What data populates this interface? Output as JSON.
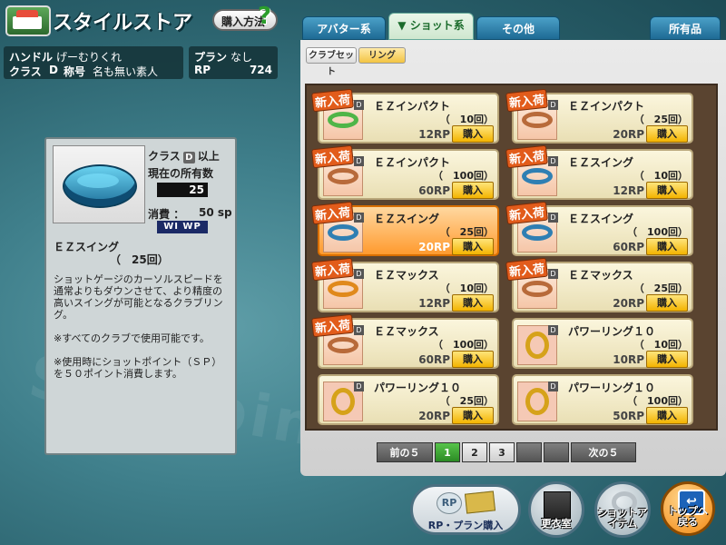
{
  "header": {
    "title": "スタイルストア",
    "howto_label": "購入方法",
    "howto_q": "?"
  },
  "user": {
    "handle_label": "ハンドル",
    "handle_value": "げーむりくれ",
    "class_label": "クラス",
    "class_value": "D",
    "title_label": "称号",
    "title_value": "名も無い素人",
    "plan_label": "プラン",
    "plan_value": "なし",
    "rp_label": "RP",
    "rp_value": "724"
  },
  "tabs": {
    "avatar": "アバター系",
    "shot": "ショット系",
    "other": "その他",
    "owned": "所有品"
  },
  "subtabs": {
    "clubset": "クラブセット",
    "ring": "リング"
  },
  "detail": {
    "class_label": "クラス",
    "class_badge": "D",
    "class_suffix": "以上",
    "owned_label": "現在の所有数",
    "owned_count": "25",
    "cost_label": "消費 ：",
    "cost_value": "50 sp",
    "wp_label": "WI WP",
    "name": "ＥＺスイング",
    "uses": "（　25回）",
    "desc1": "ショットゲージのカーソルスピードを通常よりもダウンさせて、より精度の高いスイングが可能となるクラブリング。",
    "desc2": "※すべてのクラブで使用可能です。",
    "desc3": "※使用時にショットポイント（ＳＰ）を５０ポイント消費します。"
  },
  "items": [
    {
      "name": "ＥＺインパクト",
      "uses": "（　10回）",
      "price": "12RP",
      "buy": "購入",
      "new": "新入荷",
      "color": "#4fb548"
    },
    {
      "name": "ＥＺインパクト",
      "uses": "（　25回）",
      "price": "20RP",
      "buy": "購入",
      "new": "新入荷",
      "color": "#b86a3a"
    },
    {
      "name": "ＥＺインパクト",
      "uses": "（　100回）",
      "price": "60RP",
      "buy": "購入",
      "new": "新入荷",
      "color": "#b86a3a"
    },
    {
      "name": "ＥＺスイング",
      "uses": "（　10回）",
      "price": "12RP",
      "buy": "購入",
      "new": "新入荷",
      "color": "#2f7fb3"
    },
    {
      "name": "ＥＺスイング",
      "uses": "（　25回）",
      "price": "20RP",
      "buy": "購入",
      "new": "新入荷",
      "color": "#2f7fb3"
    },
    {
      "name": "ＥＺスイング",
      "uses": "（　100回）",
      "price": "60RP",
      "buy": "購入",
      "new": "新入荷",
      "color": "#2f7fb3"
    },
    {
      "name": "ＥＺマックス",
      "uses": "（　10回）",
      "price": "12RP",
      "buy": "購入",
      "new": "新入荷",
      "color": "#e0891c"
    },
    {
      "name": "ＥＺマックス",
      "uses": "（　25回）",
      "price": "20RP",
      "buy": "購入",
      "new": "新入荷",
      "color": "#b86a3a"
    },
    {
      "name": "ＥＺマックス",
      "uses": "（　100回）",
      "price": "60RP",
      "buy": "購入",
      "new": "新入荷",
      "color": "#b86a3a"
    },
    {
      "name": "パワーリング１０",
      "uses": "（　10回）",
      "price": "10RP",
      "buy": "購入",
      "new": "",
      "color": "#d6a21a"
    },
    {
      "name": "パワーリング１０",
      "uses": "（　25回）",
      "price": "20RP",
      "buy": "購入",
      "new": "",
      "color": "#d6a21a"
    },
    {
      "name": "パワーリング１０",
      "uses": "（　100回）",
      "price": "50RP",
      "buy": "購入",
      "new": "",
      "color": "#d6a21a"
    }
  ],
  "pager": {
    "prev": "前の５",
    "p1": "1",
    "p2": "2",
    "p3": "3",
    "next": "次の５"
  },
  "bottom": {
    "rp_buy": "RP・プラン購入",
    "rp_mark": "RP",
    "wardrobe": "更衣室",
    "shot_items": "ショットアイテム",
    "top": "トップへ戻る"
  }
}
